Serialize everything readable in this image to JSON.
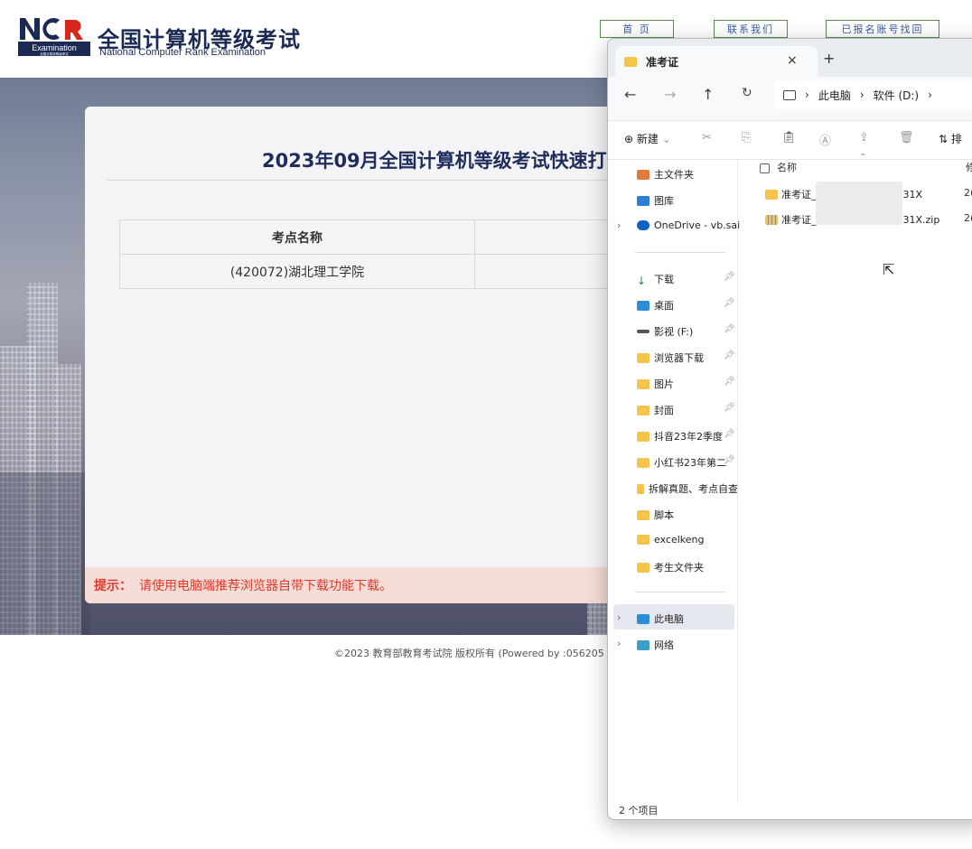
{
  "header": {
    "logo_mark": "NCR",
    "logo_badge": "Examination",
    "logo_badge_sub": "全国计算机等级考试",
    "title": "全国计算机等级考试",
    "subtitle": "National Computer Rank Examination",
    "nav": [
      "首 页",
      "联系我们",
      "已报名账号找回"
    ]
  },
  "main": {
    "title": "2023年09月全国计算机等级考试快速打",
    "table": {
      "headers": [
        "考点名称",
        ""
      ],
      "rows": [
        [
          "(420072)湖北理工学院",
          ""
        ]
      ]
    },
    "tip_label": "提示：",
    "tip_text": "请使用电脑端推荐浏览器自带下载功能下载。"
  },
  "footer": "©2023  教育部教育考试院  版权所有  (Powered by :056205",
  "explorer": {
    "tab_title": "准考证",
    "close": "×",
    "new_tab": "+",
    "breadcrumb": [
      "此电脑",
      "软件 (D:)"
    ],
    "cmd_new": "新建",
    "cmd_sort": "排",
    "sidebar": [
      {
        "label": "主文件夹",
        "icon": "home-icon",
        "pinned": false
      },
      {
        "label": "图库",
        "icon": "gallery-icon",
        "pinned": false
      },
      {
        "label": "OneDrive - vb.sai",
        "icon": "cloud-icon",
        "pinned": false
      },
      {
        "label": "下载",
        "icon": "download-icon",
        "pinned": true
      },
      {
        "label": "桌面",
        "icon": "desktop-icon",
        "pinned": true
      },
      {
        "label": "影视 (F:)",
        "icon": "drive-icon",
        "pinned": true
      },
      {
        "label": "浏览器下载",
        "icon": "folder-icon",
        "pinned": true
      },
      {
        "label": "图片",
        "icon": "folder-icon",
        "pinned": true
      },
      {
        "label": "封面",
        "icon": "folder-icon",
        "pinned": true
      },
      {
        "label": "抖音23年2季度",
        "icon": "folder-icon",
        "pinned": true
      },
      {
        "label": "小红书23年第二",
        "icon": "folder-icon",
        "pinned": true
      },
      {
        "label": "拆解真题、考点自查",
        "icon": "folder-icon",
        "pinned": false
      },
      {
        "label": "脚本",
        "icon": "folder-icon",
        "pinned": false
      },
      {
        "label": "excelkeng",
        "icon": "folder-icon",
        "pinned": false
      },
      {
        "label": "考生文件夹",
        "icon": "folder-icon",
        "pinned": false
      },
      {
        "label": "此电脑",
        "icon": "pc-icon",
        "pinned": false
      },
      {
        "label": "网络",
        "icon": "network-icon",
        "pinned": false
      }
    ],
    "column_name": "名称",
    "column_date": "修",
    "files": [
      {
        "prefix": "准考证_",
        "suffix": "31X",
        "date": "2("
      },
      {
        "prefix": "准考证_",
        "suffix": "31X.zip",
        "date": "2("
      }
    ],
    "status": "2 个项目",
    "colors": {
      "folder": "#f4c54a",
      "accent": "#0067c0"
    }
  }
}
